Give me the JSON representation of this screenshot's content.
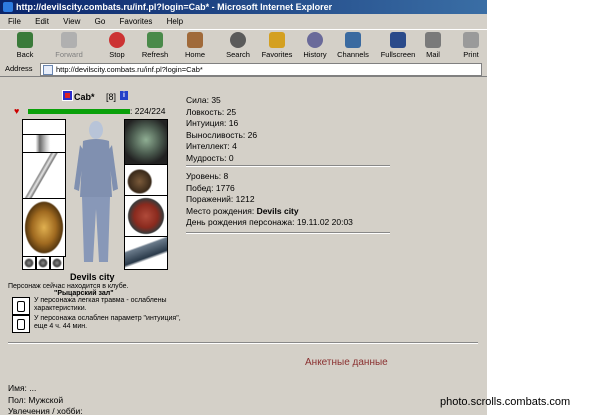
{
  "window": {
    "title": "http://devilscity.combats.ru/inf.pl?login=Cab* - Microsoft Internet Explorer"
  },
  "menu": {
    "items": [
      "File",
      "Edit",
      "View",
      "Go",
      "Favorites",
      "Help"
    ]
  },
  "toolbar": {
    "buttons": [
      {
        "label": "Back",
        "icon": "back-arrow-icon",
        "enabled": true
      },
      {
        "label": "Forward",
        "icon": "forward-arrow-icon",
        "enabled": false
      },
      {
        "label": "Stop",
        "icon": "stop-icon",
        "enabled": true
      },
      {
        "label": "Refresh",
        "icon": "refresh-icon",
        "enabled": true
      },
      {
        "label": "Home",
        "icon": "home-icon",
        "enabled": true
      },
      {
        "label": "Search",
        "icon": "search-icon",
        "enabled": true
      },
      {
        "label": "Favorites",
        "icon": "favorites-icon",
        "enabled": true
      },
      {
        "label": "History",
        "icon": "history-icon",
        "enabled": true
      },
      {
        "label": "Channels",
        "icon": "channels-icon",
        "enabled": true
      },
      {
        "label": "Fullscreen",
        "icon": "fullscreen-icon",
        "enabled": true
      },
      {
        "label": "Mail",
        "icon": "mail-icon",
        "enabled": true
      },
      {
        "label": "Print",
        "icon": "print-icon",
        "enabled": true
      }
    ]
  },
  "address": {
    "label": "Address",
    "url": "http://devilscity.combats.ru/inf.pl?login=Cab*"
  },
  "character": {
    "nick": "Cab*",
    "level": "[8]",
    "hp": ": 224/224",
    "hp_fraction": 1.0,
    "city": "Devils city",
    "location_text": "Персонаж сейчас находится в клубе.",
    "hall": "\"Рыцарский зал\"",
    "effects": [
      "У персонажа легкая травма - ослаблены характеристики.",
      "У персонажа ослаблен параметр \"интуиция\", еще 4 ч. 44 мин."
    ]
  },
  "stats": {
    "attributes": [
      {
        "name": "Сила:",
        "value": "35"
      },
      {
        "name": "Ловкость:",
        "value": "25"
      },
      {
        "name": "Интуиция:",
        "value": "16"
      },
      {
        "name": "Выносливость:",
        "value": "26"
      },
      {
        "name": "Интеллект:",
        "value": "4"
      },
      {
        "name": "Мудрость:",
        "value": "0"
      }
    ],
    "progress": [
      {
        "name": "Уровень:",
        "value": "8"
      },
      {
        "name": "Побед:",
        "value": "1776"
      },
      {
        "name": "Поражений:",
        "value": "1212"
      }
    ],
    "birthplace_label": "Место рождения:",
    "birthplace": "Devils city",
    "birthday_label": "День рождения персонажа:",
    "birthday": "19.11.02 20:03"
  },
  "profile": {
    "heading": "Анкетные данные",
    "fields": [
      "Имя: ...",
      "Пол: Мужской",
      "Увлечения / хобби:"
    ]
  },
  "watermark": "photo.scrolls.combats.com"
}
